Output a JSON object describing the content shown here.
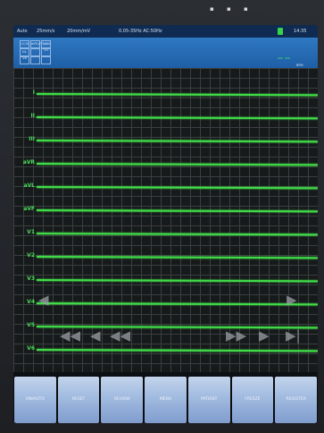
{
  "status_bar": {
    "mode": "Auto",
    "speed": "25mm/s",
    "gain": "20mm/mV",
    "filter": "0.05-35Hz  AC:50Hz",
    "clock": "14:35"
  },
  "info_panel": {
    "lead_groups": [
      "I,II,III",
      "aVR,aVL,aVF",
      "V1-V3",
      "V4-V6"
    ],
    "heart_rate": "-- --",
    "small_label": "BPM"
  },
  "leads": [
    "I",
    "II",
    "III",
    "aVR",
    "aVL",
    "aVF",
    "V1",
    "V2",
    "V3",
    "V4",
    "V5",
    "V6"
  ],
  "controls": {
    "page_left_icon": "◀",
    "page_right_icon": "▶",
    "rewind_icon": "◀◀",
    "step_back_icon": "◀",
    "fast_back_icon": "◀◀",
    "fast_forward_icon": "▶▶",
    "play_icon": "▶",
    "end_icon": "▶|"
  },
  "softkeys": [
    "ON/AUTO",
    "RESET",
    "REVIEW",
    "MENU",
    "PATIENT",
    "FREEZE",
    "REGISTER"
  ],
  "colors": {
    "trace": "#41dc49",
    "header": "#2f78c2",
    "grid": "#3a3e40"
  }
}
